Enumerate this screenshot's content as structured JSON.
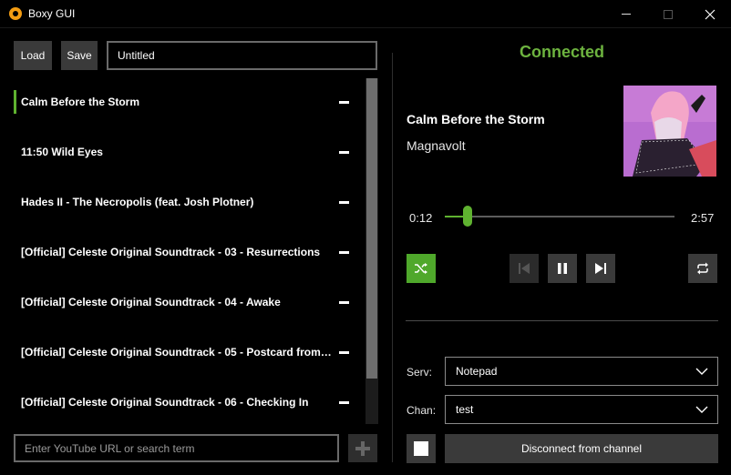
{
  "window": {
    "title": "Boxy GUI"
  },
  "toolbar": {
    "load_label": "Load",
    "save_label": "Save",
    "playlist_name": "Untitled"
  },
  "playlist": {
    "tracks": [
      {
        "title": "Calm Before the Storm",
        "active": true
      },
      {
        "title": "11:50 Wild Eyes",
        "active": false
      },
      {
        "title": "Hades II - The Necropolis (feat. Josh Plotner)",
        "active": false
      },
      {
        "title": "[Official] Celeste Original Soundtrack - 03 - Resurrections",
        "active": false
      },
      {
        "title": "[Official] Celeste Original Soundtrack - 04 - Awake",
        "active": false
      },
      {
        "title": "[Official] Celeste Original Soundtrack - 05 - Postcard from…",
        "active": false
      },
      {
        "title": "[Official] Celeste Original Soundtrack - 06 - Checking In",
        "active": false
      }
    ]
  },
  "search": {
    "placeholder": "Enter YouTube URL or search term"
  },
  "status": {
    "text": "Connected",
    "color": "#6db33f"
  },
  "now_playing": {
    "title": "Calm Before the Storm",
    "artist": "Magnavolt",
    "current_time": "0:12",
    "duration": "2:57",
    "progress": 0.1
  },
  "controls": {
    "shuffle_icon": "shuffle-icon",
    "prev_icon": "skip-previous-icon",
    "pause_icon": "pause-icon",
    "next_icon": "skip-next-icon",
    "repeat_icon": "repeat-icon"
  },
  "connection": {
    "server_label": "Serv:",
    "server_value": "Notepad",
    "channel_label": "Chan:",
    "channel_value": "test",
    "disconnect_label": "Disconnect from channel"
  },
  "colors": {
    "accent": "#5fb230",
    "button_bg": "#3a3a3a"
  }
}
